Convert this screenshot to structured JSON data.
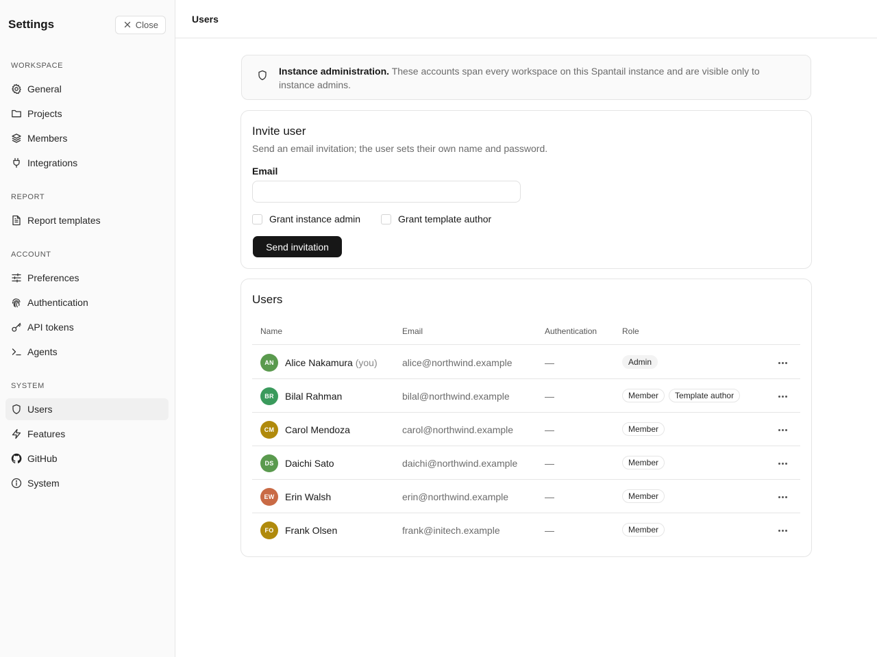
{
  "sidebar": {
    "title": "Settings",
    "close_label": "Close",
    "sections": [
      {
        "label": "Workspace",
        "items": [
          {
            "label": "General",
            "icon": "gear-icon"
          },
          {
            "label": "Projects",
            "icon": "folder-icon"
          },
          {
            "label": "Members",
            "icon": "layers-icon"
          },
          {
            "label": "Integrations",
            "icon": "plug-icon"
          }
        ]
      },
      {
        "label": "Report",
        "items": [
          {
            "label": "Report templates",
            "icon": "file-text-icon"
          }
        ]
      },
      {
        "label": "Account",
        "items": [
          {
            "label": "Preferences",
            "icon": "sliders-icon"
          },
          {
            "label": "Authentication",
            "icon": "fingerprint-icon"
          },
          {
            "label": "API tokens",
            "icon": "key-icon"
          },
          {
            "label": "Agents",
            "icon": "terminal-icon"
          }
        ]
      },
      {
        "label": "System",
        "items": [
          {
            "label": "Users",
            "icon": "shield-icon",
            "active": true
          },
          {
            "label": "Features",
            "icon": "zap-icon"
          },
          {
            "label": "GitHub",
            "icon": "github-icon"
          },
          {
            "label": "System",
            "icon": "info-icon"
          }
        ]
      }
    ]
  },
  "header": {
    "title": "Users"
  },
  "notice": {
    "icon": "shield-icon",
    "strong": "Instance administration.",
    "text": "These accounts span every workspace on this Spantail instance and are visible only to instance admins."
  },
  "invite": {
    "title": "Invite user",
    "subtitle": "Send an email invitation; the user sets their own name and password.",
    "email_label": "Email",
    "email_value": "",
    "email_placeholder": "",
    "grant_admin_label": "Grant instance admin",
    "grant_template_label": "Grant template author",
    "submit_label": "Send invitation"
  },
  "users": {
    "title": "Users",
    "columns": [
      "Name",
      "Email",
      "Authentication",
      "Role"
    ],
    "rows": [
      {
        "initials": "AN",
        "name": "Alice Nakamura",
        "suffix": "(you)",
        "email": "alice@northwind.example",
        "auth": "—",
        "roles": [
          "Admin"
        ],
        "avatar_color": "#5a9a4e"
      },
      {
        "initials": "BR",
        "name": "Bilal Rahman",
        "suffix": "",
        "email": "bilal@northwind.example",
        "auth": "—",
        "roles": [
          "Member",
          "Template author"
        ],
        "avatar_color": "#3a9a5c"
      },
      {
        "initials": "CM",
        "name": "Carol Mendoza",
        "suffix": "",
        "email": "carol@northwind.example",
        "auth": "—",
        "roles": [
          "Member"
        ],
        "avatar_color": "#b08a0c"
      },
      {
        "initials": "DS",
        "name": "Daichi Sato",
        "suffix": "",
        "email": "daichi@northwind.example",
        "auth": "—",
        "roles": [
          "Member"
        ],
        "avatar_color": "#5a9a4e"
      },
      {
        "initials": "EW",
        "name": "Erin Walsh",
        "suffix": "",
        "email": "erin@northwind.example",
        "auth": "—",
        "roles": [
          "Member"
        ],
        "avatar_color": "#c96a45"
      },
      {
        "initials": "FO",
        "name": "Frank Olsen",
        "suffix": "",
        "email": "frank@initech.example",
        "auth": "—",
        "roles": [
          "Member"
        ],
        "avatar_color": "#b08a0c"
      }
    ]
  }
}
